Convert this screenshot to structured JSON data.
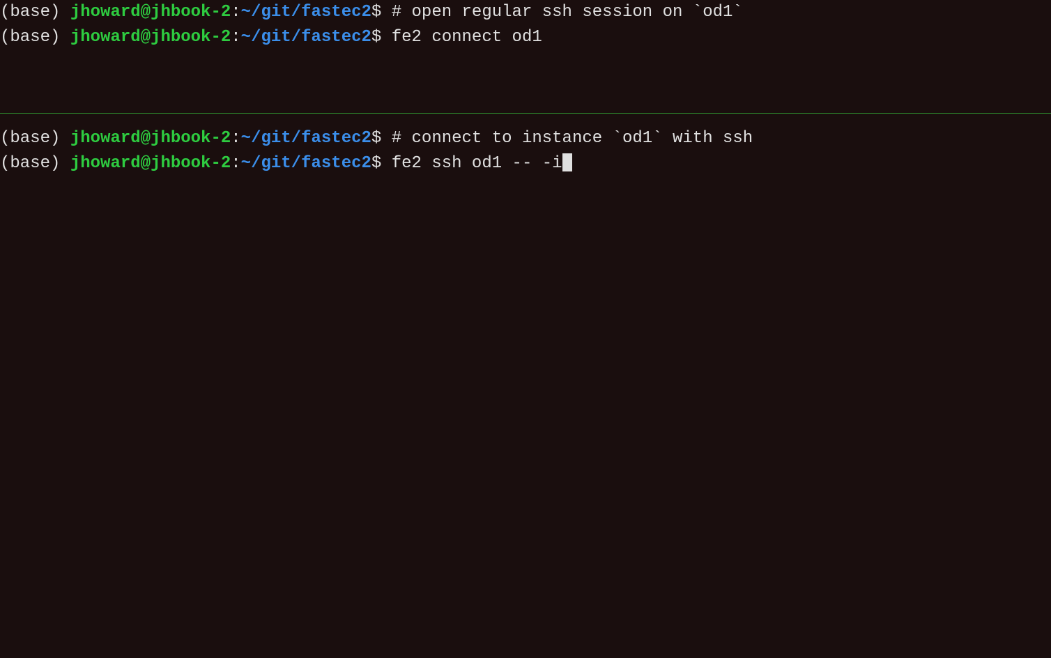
{
  "prompt": {
    "env": "(base) ",
    "user_host": "jhoward@jhbook-2",
    "colon": ":",
    "path": "~/git/fastec2",
    "dollar": "$"
  },
  "top_pane": {
    "lines": [
      {
        "cmd": " # open regular ssh session on `od1`"
      },
      {
        "cmd": " fe2 connect od1"
      }
    ]
  },
  "bottom_pane": {
    "lines": [
      {
        "cmd": " # connect to instance `od1` with ssh",
        "cursor": false
      },
      {
        "cmd": " fe2 ssh od1 -- -i",
        "cursor": true
      }
    ]
  },
  "colors": {
    "background": "#1a0e0e",
    "text": "#e0e0e0",
    "green": "#2ecc40",
    "blue": "#3b8eea",
    "divider": "#2e8b2e"
  }
}
